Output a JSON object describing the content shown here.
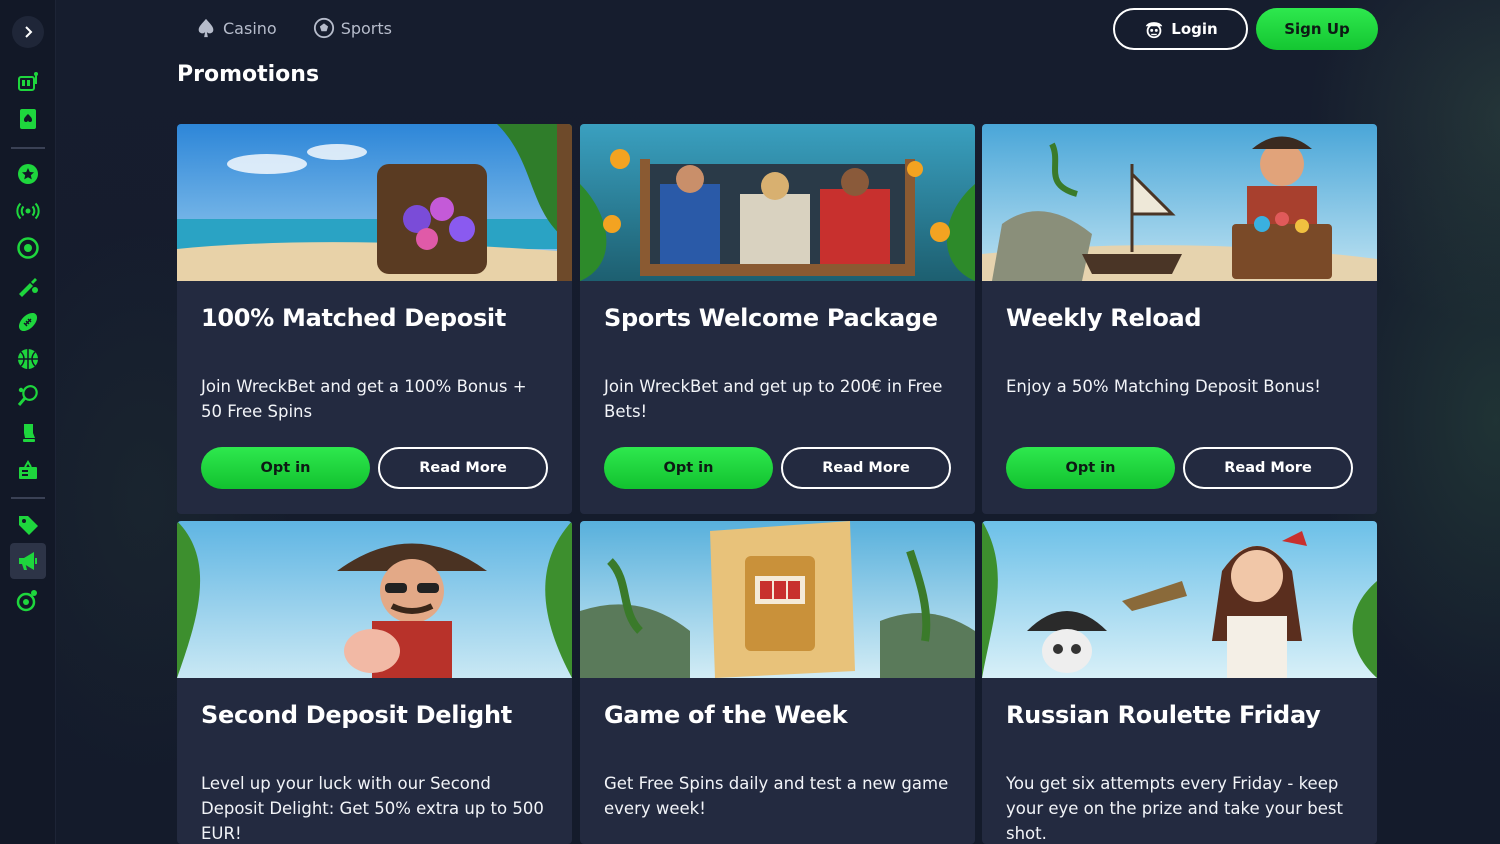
{
  "nav": {
    "casino_label": "Casino",
    "sports_label": "Sports",
    "login_label": "Login",
    "signup_label": "Sign Up"
  },
  "page": {
    "title": "Promotions"
  },
  "sidebar": {
    "items": [
      {
        "icon": "slot-machine-icon"
      },
      {
        "icon": "card-spade-icon"
      },
      {
        "icon": "star-badge-icon"
      },
      {
        "icon": "live-broadcast-icon"
      },
      {
        "icon": "soccer-ball-icon"
      },
      {
        "icon": "cricket-icon"
      },
      {
        "icon": "american-football-icon"
      },
      {
        "icon": "basketball-icon"
      },
      {
        "icon": "tennis-icon"
      },
      {
        "icon": "ice-hockey-icon"
      },
      {
        "icon": "esports-icon"
      },
      {
        "icon": "tag-icon"
      },
      {
        "icon": "megaphone-icon"
      },
      {
        "icon": "wheel-icon"
      }
    ]
  },
  "promotions": [
    {
      "title": "100% Matched Deposit",
      "description": "Join WreckBet and get a 100% Bonus + 50 Free Spins",
      "optin_label": "Opt in",
      "read_label": "Read More"
    },
    {
      "title": "Sports Welcome Package",
      "description": "Join WreckBet and get up to 200€ in Free Bets!",
      "optin_label": "Opt in",
      "read_label": "Read More"
    },
    {
      "title": "Weekly Reload",
      "description": "Enjoy a 50% Matching Deposit Bonus!",
      "optin_label": "Opt in",
      "read_label": "Read More"
    },
    {
      "title": "Second Deposit Delight",
      "description": "Level up your luck with our Second Deposit Delight: Get 50% extra up to 500 EUR!"
    },
    {
      "title": "Game of the Week",
      "description": "Get Free Spins daily and test a new game every week!"
    },
    {
      "title": "Russian Roulette Friday",
      "description": "You get six attempts every Friday - keep your eye on the prize and take your best shot."
    }
  ],
  "colors": {
    "accent_green": "#1ed63d",
    "background": "#131a2b",
    "card": "#232a40"
  }
}
